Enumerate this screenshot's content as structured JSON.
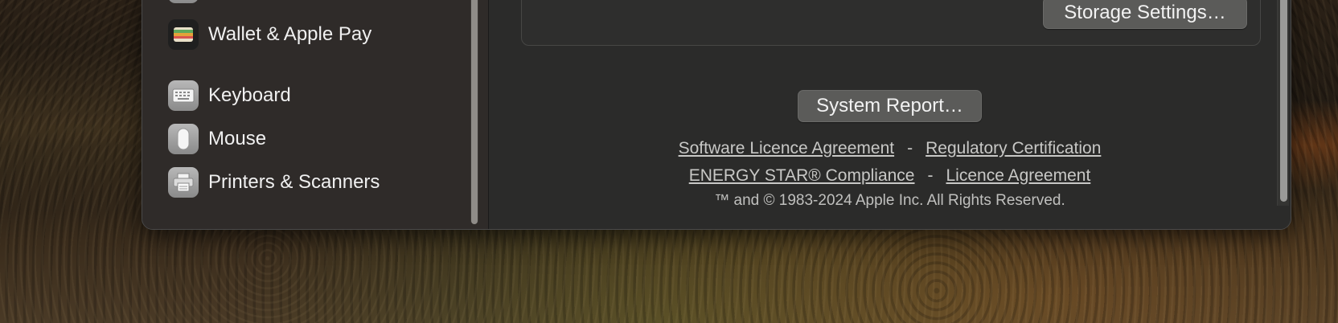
{
  "sidebar": {
    "items": [
      {
        "label": "Wallet & Apple Pay",
        "icon": "wallet-icon"
      },
      {
        "label": "Keyboard",
        "icon": "keyboard-icon"
      },
      {
        "label": "Mouse",
        "icon": "mouse-icon"
      },
      {
        "label": "Printers & Scanners",
        "icon": "printer-icon"
      }
    ]
  },
  "main": {
    "storage_settings_label": "Storage Settings…",
    "system_report_label": "System Report…",
    "links": {
      "software_licence": "Software Licence Agreement",
      "regulatory": "Regulatory Certification",
      "energy_star": "ENERGY STAR® Compliance",
      "licence": "Licence Agreement",
      "separator": "-"
    },
    "copyright": "™ and © 1983-2024 Apple Inc. All Rights Reserved."
  }
}
